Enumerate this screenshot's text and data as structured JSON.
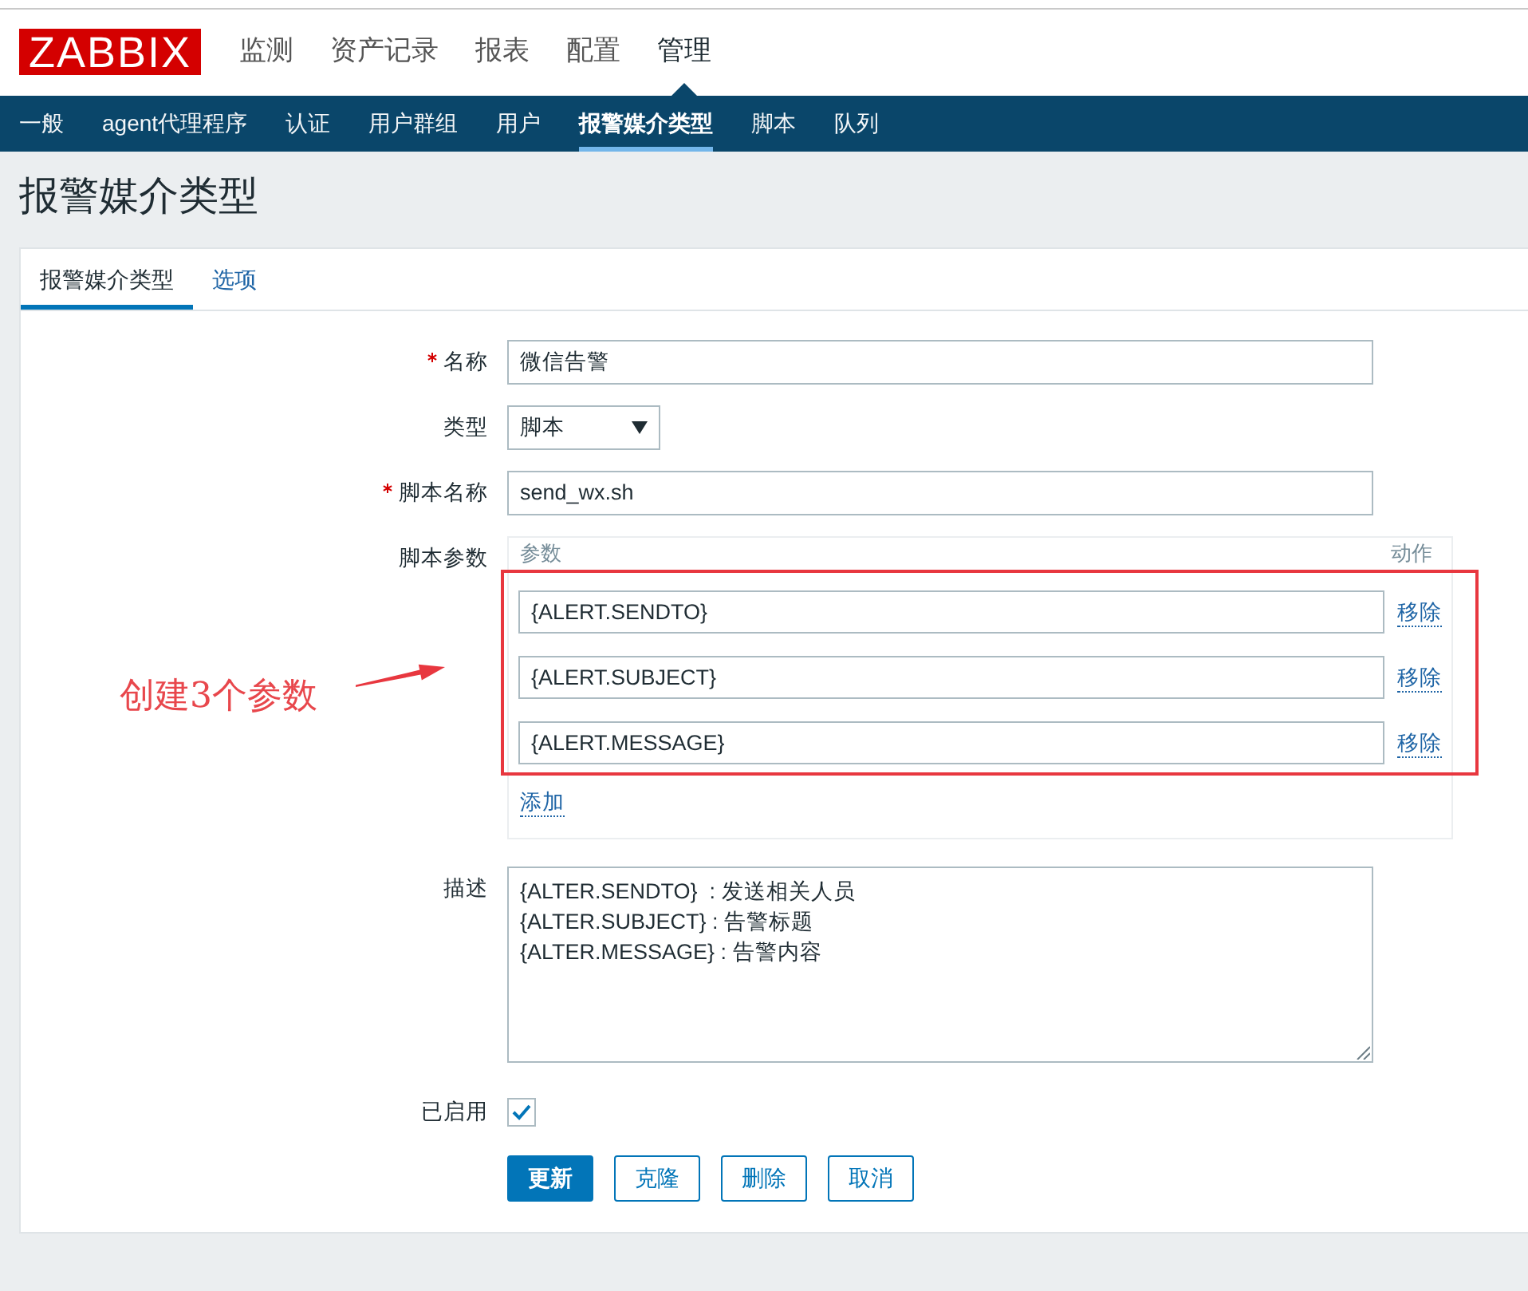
{
  "logo": {
    "text": "ZABBIX"
  },
  "main_menu": [
    {
      "label": "监测",
      "selected": false
    },
    {
      "label": "资产记录",
      "selected": false
    },
    {
      "label": "报表",
      "selected": false
    },
    {
      "label": "配置",
      "selected": false
    },
    {
      "label": "管理",
      "selected": true
    }
  ],
  "sub_menu": [
    {
      "label": "一般",
      "selected": false
    },
    {
      "label": "agent代理程序",
      "selected": false
    },
    {
      "label": "认证",
      "selected": false
    },
    {
      "label": "用户群组",
      "selected": false
    },
    {
      "label": "用户",
      "selected": false
    },
    {
      "label": "报警媒介类型",
      "selected": true
    },
    {
      "label": "脚本",
      "selected": false
    },
    {
      "label": "队列",
      "selected": false
    }
  ],
  "page_title": "报警媒介类型",
  "tabs": [
    {
      "label": "报警媒介类型",
      "selected": true
    },
    {
      "label": "选项",
      "selected": false
    }
  ],
  "form": {
    "fields": [
      {
        "kind": "text",
        "label": "名称",
        "required": true,
        "value": "微信告警"
      },
      {
        "kind": "select",
        "label": "类型",
        "required": false,
        "value": "脚本"
      },
      {
        "kind": "text",
        "label": "脚本名称",
        "required": true,
        "value": "send_wx.sh"
      },
      {
        "kind": "params",
        "label": "脚本参数",
        "required": false,
        "param_header": "参数",
        "action_header": "动作",
        "rows": [
          {
            "value": "{ALERT.SENDTO}",
            "action": "移除"
          },
          {
            "value": "{ALERT.SUBJECT}",
            "action": "移除"
          },
          {
            "value": "{ALERT.MESSAGE}",
            "action": "移除"
          }
        ],
        "add_label": "添加"
      },
      {
        "kind": "textarea",
        "label": "描述",
        "required": false,
        "value": "{ALTER.SENDTO}  : 发送相关人员\n{ALTER.SUBJECT} : 告警标题\n{ALTER.MESSAGE} : 告警内容"
      },
      {
        "kind": "checkbox",
        "label": "已启用",
        "required": false,
        "checked": true
      }
    ],
    "buttons": [
      {
        "label": "更新",
        "kind": "primary"
      },
      {
        "label": "克隆",
        "kind": "secondary"
      },
      {
        "label": "删除",
        "kind": "secondary"
      },
      {
        "label": "取消",
        "kind": "secondary"
      }
    ]
  },
  "annotation": {
    "text": "创建3个参数"
  }
}
